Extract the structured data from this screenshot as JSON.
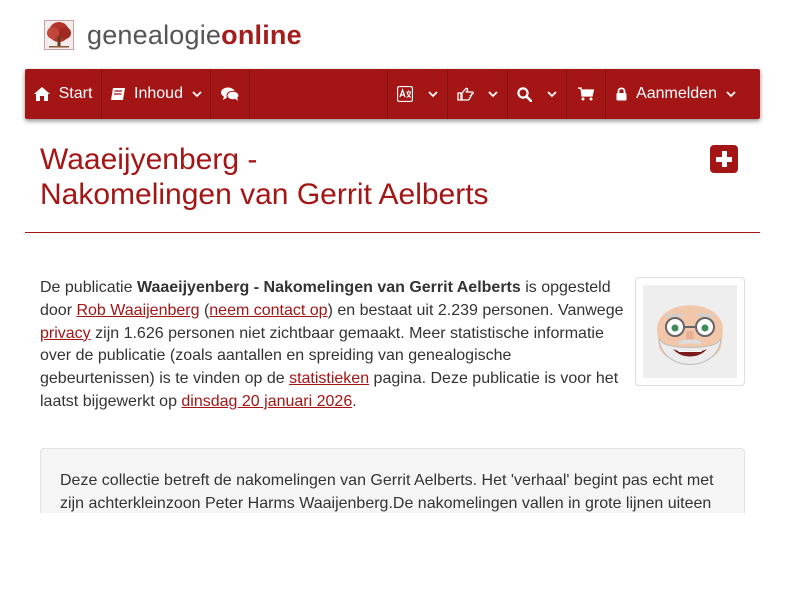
{
  "logo": {
    "part1": "genealogie",
    "part2": "online"
  },
  "nav": {
    "start": "Start",
    "inhoud": "Inhoud",
    "login": "Aanmelden"
  },
  "title": {
    "line1": "Waaeijyenberg -",
    "line2": "Nakomelingen van Gerrit Aelberts"
  },
  "description": {
    "t1": "De publicatie ",
    "pub_title": "Waaeijyenberg - Nakomelingen van Gerrit Aelberts",
    "t2": " is opgesteld door ",
    "author": "Rob Waaijenberg",
    "t3": " (",
    "contact": "neem contact op",
    "t4": ") en bestaat uit 2.239 personen. Vanwege ",
    "privacy": "privacy",
    "t5": " zijn 1.626 personen niet zichtbaar gemaakt. Meer statistische informatie over de publicatie (zoals aantallen en spreiding van genealogische gebeurtenissen) is te vinden op de ",
    "stats": "statistieken",
    "t6": " pagina. Deze publicatie is voor het laatst bijgewerkt op ",
    "date": "dinsdag 20 januari 2026",
    "t7": "."
  },
  "collection_text": "Deze collectie betreft de nakomelingen van Gerrit Aelberts. Het 'verhaal' begint pas echt met zijn achterkleinzoon Peter Harms Waaijenberg.De nakomelingen vallen in grote lijnen uiteen",
  "colors": {
    "brand": "#a41515",
    "text": "#333333"
  },
  "icons": [
    "tree-logo-icon",
    "home-icon",
    "book-icon",
    "comments-icon",
    "translate-icon",
    "hand-pointer-icon",
    "search-icon",
    "cart-icon",
    "lock-icon",
    "plus-square-icon"
  ]
}
